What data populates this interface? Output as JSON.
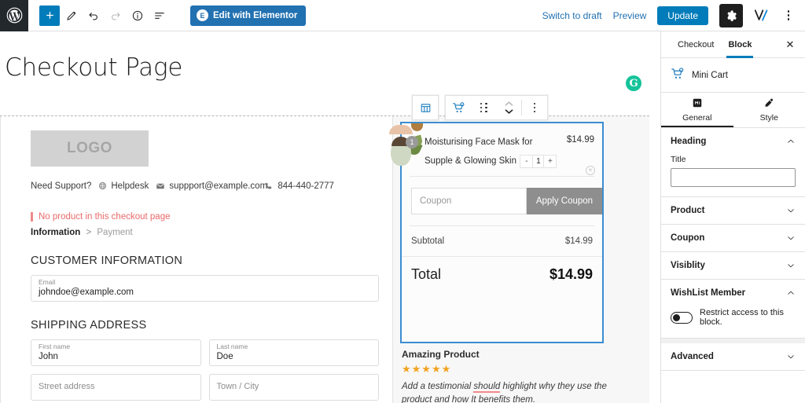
{
  "adminbar": {
    "wp_logo_icon": "wordpress-logo",
    "tools": [
      {
        "name": "add-block-button",
        "icon": "plus-icon",
        "label": "+"
      },
      {
        "name": "edit-tool-button",
        "icon": "pencil-icon",
        "label": ""
      },
      {
        "name": "undo-button",
        "icon": "undo-arrow-icon",
        "label": ""
      },
      {
        "name": "redo-button",
        "icon": "redo-arrow-icon",
        "label": ""
      },
      {
        "name": "details-button",
        "icon": "info-circle-icon",
        "label": ""
      },
      {
        "name": "list-view-button",
        "icon": "list-view-icon",
        "label": ""
      }
    ],
    "elementor_button": "Edit with Elementor",
    "elementor_badge": "E",
    "switch_to_draft": "Switch to draft",
    "preview": "Preview",
    "update": "Update",
    "settings_icon": "gear-icon",
    "visual_composer_icon": "vw-icon",
    "more_icon": "kebab-menu-icon"
  },
  "canvas": {
    "page_title": "Checkout Page",
    "grammarly_icon": "grammarly-icon",
    "grammarly_glyph": "G",
    "block_toolbar": {
      "column_icon": "columns-block-icon",
      "minicart_icon": "mini-cart-icon",
      "drag_icon": "drag-handle-icon",
      "move_up_icon": "chevron-up-icon",
      "move_down_icon": "chevron-down-icon",
      "options_icon": "more-options-icon"
    },
    "left": {
      "logo_text": "LOGO",
      "support_label": "Need Support?",
      "support_items": [
        {
          "icon": "globe-icon",
          "text": "Helpdesk"
        },
        {
          "icon": "envelope-icon",
          "text": "suppport@example.com"
        },
        {
          "icon": "phone-icon",
          "text": "844-440-2777"
        }
      ],
      "notice": "No product in this checkout page",
      "breadcrumb": {
        "current": "Information",
        "separator": ">",
        "next": "Payment"
      },
      "customer_information_title": "CUSTOMER INFORMATION",
      "email_field": {
        "label": "Email",
        "value": "johndoe@example.com"
      },
      "shipping_address_title": "SHIPPING ADDRESS",
      "first_name_field": {
        "label": "First name",
        "value": "John"
      },
      "last_name_field": {
        "label": "Last name",
        "value": "Doe"
      },
      "street_address_field": {
        "label": "Street address",
        "value": ""
      },
      "town_city_field": {
        "label": "Town / City",
        "value": ""
      }
    },
    "cart": {
      "item": {
        "name": "Moisturising Face Mask for Supple & Glowing Skin",
        "price": "$14.99",
        "qty_badge": "1",
        "qty_minus": "-",
        "qty_value": "1",
        "qty_plus": "+",
        "remove_icon": "remove-item-icon",
        "remove_glyph": "×",
        "thumbnail_alt": "face-mask-product-thumbnail"
      },
      "coupon_placeholder": "Coupon",
      "apply_coupon": "Apply Coupon",
      "subtotal_label": "Subtotal",
      "subtotal_value": "$14.99",
      "total_label": "Total",
      "total_value": "$14.99"
    },
    "testimonial": {
      "title": "Amazing Product",
      "stars": "★★★★★",
      "rating": 5,
      "body_part1": "Add a testimonial ",
      "body_misspelled": "should",
      "body_part2": " highlight why they use the product and how It benefits them."
    }
  },
  "sidebar": {
    "tabs": [
      {
        "label": "Checkout",
        "active": false
      },
      {
        "label": "Block",
        "active": true
      }
    ],
    "close_icon": "close-icon",
    "close_glyph": "✕",
    "block": {
      "icon": "mini-cart-icon",
      "name": "Mini Cart"
    },
    "mode_tabs": [
      {
        "label": "General",
        "icon": "general-settings-icon",
        "active": true
      },
      {
        "label": "Style",
        "icon": "paintbrush-icon",
        "active": false
      }
    ],
    "panels": [
      {
        "name": "heading",
        "title": "Heading",
        "expanded": true,
        "chevron": "chevron-up-icon"
      },
      {
        "name": "product",
        "title": "Product",
        "expanded": false,
        "chevron": "chevron-down-icon"
      },
      {
        "name": "coupon",
        "title": "Coupon",
        "expanded": false,
        "chevron": "chevron-down-icon"
      },
      {
        "name": "visiblity",
        "title": "Visiblity",
        "expanded": false,
        "chevron": "chevron-down-icon"
      },
      {
        "name": "wishlist-member",
        "title": "WishList Member",
        "expanded": true,
        "chevron": "chevron-up-icon"
      },
      {
        "name": "advanced",
        "title": "Advanced",
        "expanded": false,
        "chevron": "chevron-down-icon"
      }
    ],
    "title_field_label": "Title",
    "title_field_value": "",
    "restrict_toggle_label": "Restrict access to this block.",
    "restrict_toggle_on": false
  },
  "colors": {
    "wp_blue": "#007cba",
    "elementor_blue": "#2271b1",
    "selection_blue": "#3b8dd0",
    "notice_red": "#ea6a6a",
    "star_orange": "#f2a31e",
    "grammarly_green": "#15c39a",
    "apply_gray": "#8e8e8e"
  }
}
